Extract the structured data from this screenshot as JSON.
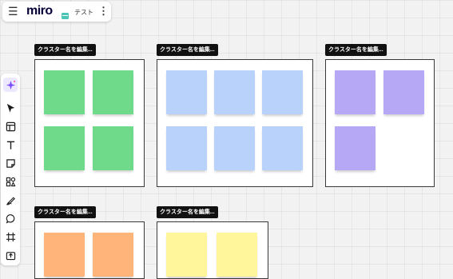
{
  "app": {
    "logo": "miro",
    "board_name": "テスト"
  },
  "colors": {
    "green": "#6fdb8a",
    "blue": "#b8d2fb",
    "purple": "#b7a8f5",
    "orange": "#ffb57a",
    "yellow": "#fff59b",
    "board_icon": "#4bc5b5"
  },
  "toolbar": [
    "ai-sparkle-icon",
    "select-cursor-icon",
    "templates-icon",
    "text-icon",
    "sticky-note-icon",
    "shapes-icon",
    "pen-icon",
    "comment-icon",
    "frame-icon",
    "upload-icon"
  ],
  "frames": [
    {
      "label": "クラスター名を編集...",
      "color": "green",
      "note_count": 4
    },
    {
      "label": "クラスター名を編集...",
      "color": "blue",
      "note_count": 6
    },
    {
      "label": "クラスター名を編集...",
      "color": "purple",
      "note_count": 3
    },
    {
      "label": "クラスター名を編集...",
      "color": "orange",
      "note_count": 2
    },
    {
      "label": "クラスター名を編集...",
      "color": "yellow",
      "note_count": 2
    }
  ]
}
